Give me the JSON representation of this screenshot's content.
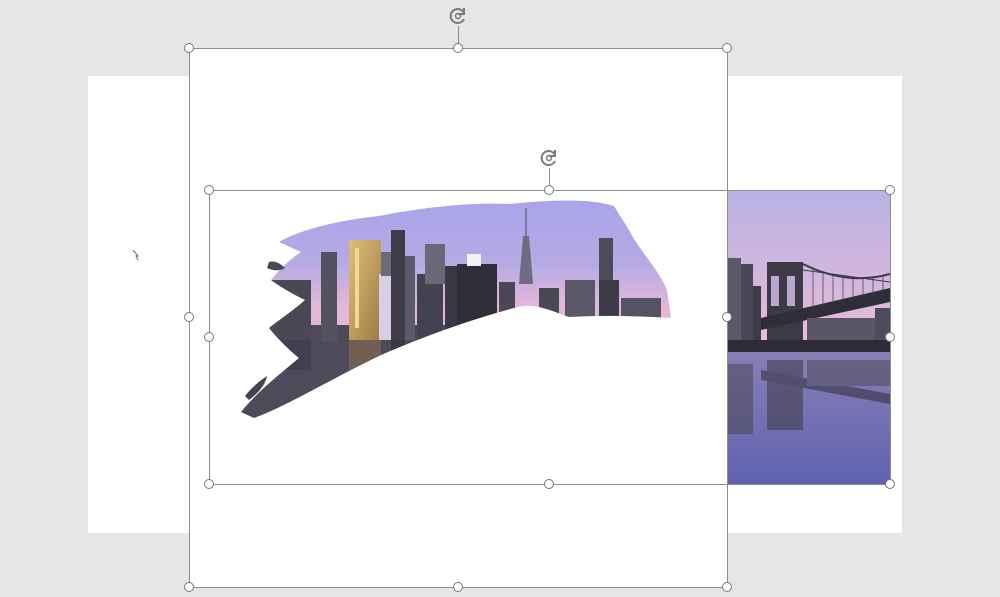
{
  "canvas": {
    "background": "#e6e6e6",
    "slide_color": "#ffffff",
    "selection_border_color": "#8e8e8e",
    "handle_fill": "#ffffff"
  },
  "outer_selection": {
    "rotate_icon": "rotate-arrow-icon",
    "handles": [
      "top-left",
      "top-center",
      "top-right",
      "middle-left",
      "middle-right",
      "bottom-left",
      "bottom-center",
      "bottom-right"
    ]
  },
  "inner_selection": {
    "rotate_icon": "rotate-arrow-icon",
    "handles": [
      "top-left",
      "top-center",
      "top-right",
      "middle-left",
      "middle-right",
      "bottom-left",
      "bottom-center",
      "bottom-right"
    ]
  },
  "images": {
    "city_skyline": {
      "sky_top": "#aaa6e8",
      "sky_pink": "#e9b8d8",
      "building_dark": "#3b3a44",
      "building_gold": "#c9a25a"
    },
    "bridge_photo": {
      "sky_top": "#c7bfe6",
      "sky_pink": "#e8b4d2",
      "water": "#6f6fb4",
      "bridge": "#3c3a45"
    }
  }
}
